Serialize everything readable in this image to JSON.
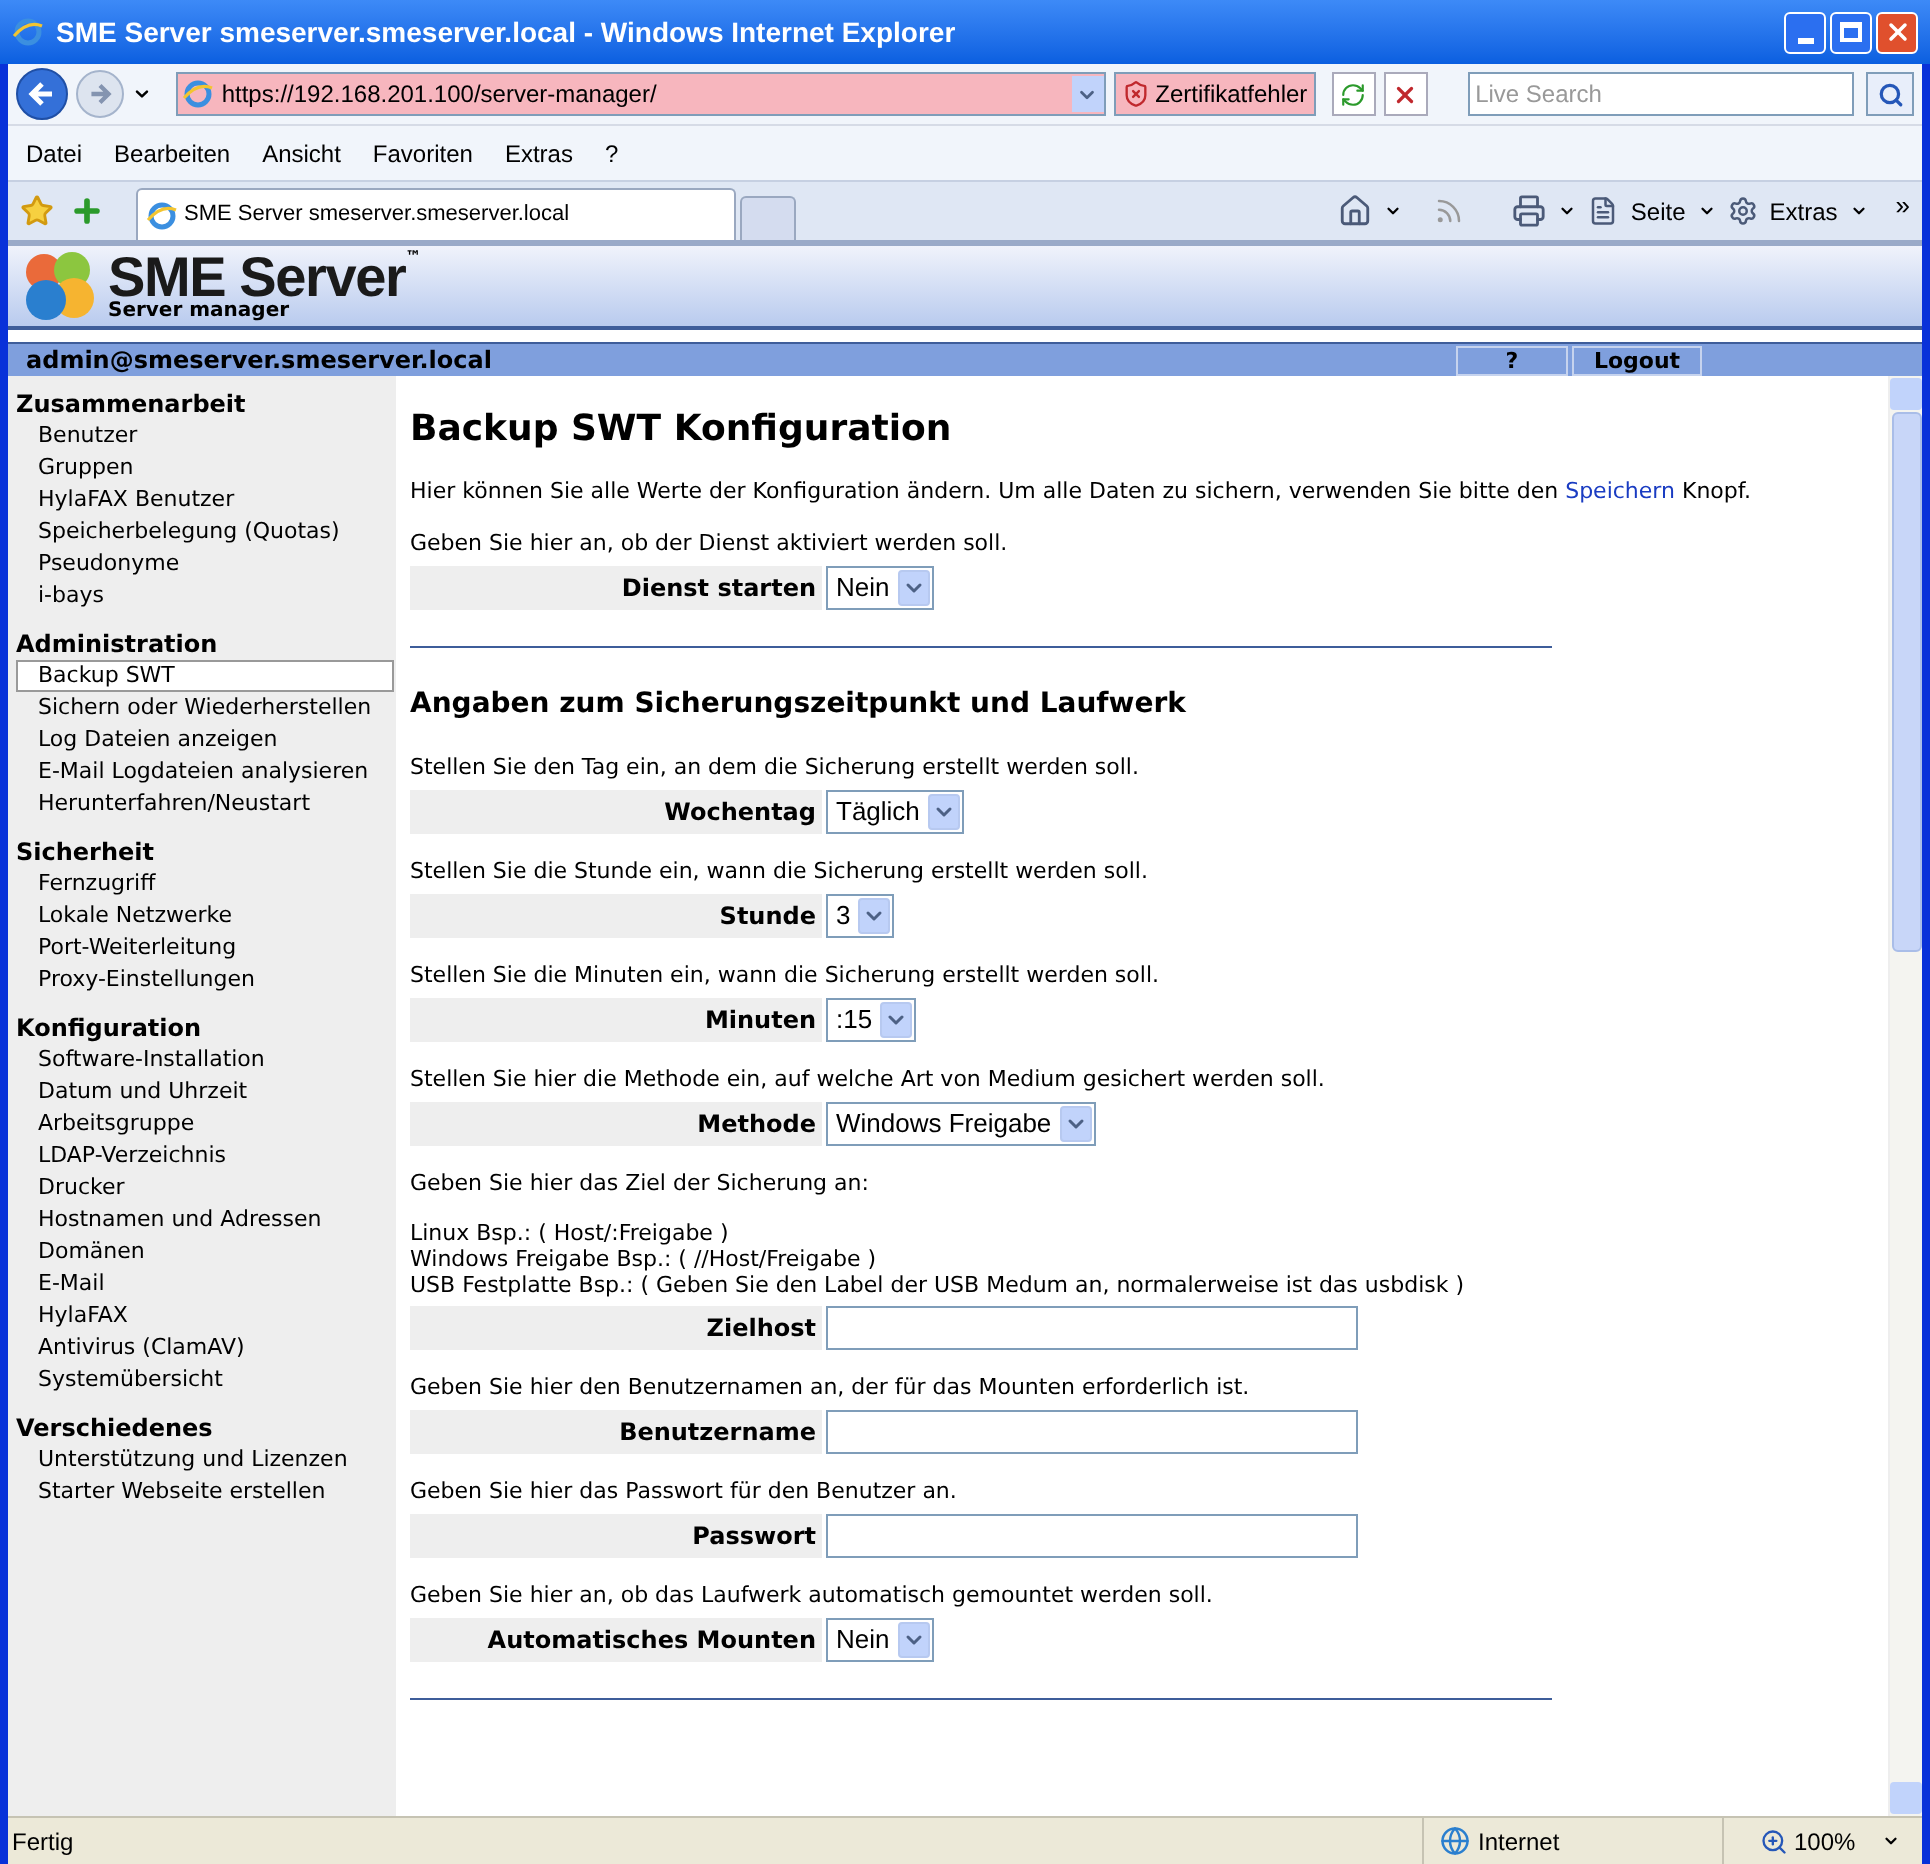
{
  "window": {
    "title": "SME Server smeserver.smeserver.local - Windows Internet Explorer"
  },
  "address_bar": {
    "url": "https://192.168.201.100/server-manager/",
    "certificate_error": "Zertifikatfehler",
    "search_placeholder": "Live Search"
  },
  "menu": [
    "Datei",
    "Bearbeiten",
    "Ansicht",
    "Favoriten",
    "Extras",
    "?"
  ],
  "tabs": [
    {
      "label": "SME Server smeserver.smeserver.local",
      "selected": true
    }
  ],
  "command_bar": {
    "page": "Seite",
    "tools": "Extras",
    "more": "»"
  },
  "header": {
    "logo": "SME Server",
    "trademark": "™",
    "subtitle": "Server manager"
  },
  "user_bar": {
    "user": "admin@smeserver.smeserver.local",
    "help": "?",
    "logout": "Logout"
  },
  "sidebar": [
    {
      "title": "Zusammenarbeit",
      "items": [
        {
          "label": "Benutzer",
          "selected": false
        },
        {
          "label": "Gruppen",
          "selected": false
        },
        {
          "label": "HylaFAX Benutzer",
          "selected": false
        },
        {
          "label": "Speicherbelegung (Quotas)",
          "selected": false
        },
        {
          "label": "Pseudonyme",
          "selected": false
        },
        {
          "label": "i-bays",
          "selected": false
        }
      ]
    },
    {
      "title": "Administration",
      "items": [
        {
          "label": "Backup SWT",
          "selected": true
        },
        {
          "label": "Sichern oder Wiederherstellen",
          "selected": false
        },
        {
          "label": "Log Dateien anzeigen",
          "selected": false
        },
        {
          "label": "E-Mail Logdateien analysieren",
          "selected": false
        },
        {
          "label": "Herunterfahren/Neustart",
          "selected": false
        }
      ]
    },
    {
      "title": "Sicherheit",
      "items": [
        {
          "label": "Fernzugriff",
          "selected": false
        },
        {
          "label": "Lokale Netzwerke",
          "selected": false
        },
        {
          "label": "Port-Weiterleitung",
          "selected": false
        },
        {
          "label": "Proxy-Einstellungen",
          "selected": false
        }
      ]
    },
    {
      "title": "Konfiguration",
      "items": [
        {
          "label": "Software-Installation",
          "selected": false
        },
        {
          "label": "Datum und Uhrzeit",
          "selected": false
        },
        {
          "label": "Arbeitsgruppe",
          "selected": false
        },
        {
          "label": "LDAP-Verzeichnis",
          "selected": false
        },
        {
          "label": "Drucker",
          "selected": false
        },
        {
          "label": "Hostnamen und Adressen",
          "selected": false
        },
        {
          "label": "Domänen",
          "selected": false
        },
        {
          "label": "E-Mail",
          "selected": false
        },
        {
          "label": "HylaFAX",
          "selected": false
        },
        {
          "label": "Antivirus (ClamAV)",
          "selected": false
        },
        {
          "label": "Systemübersicht",
          "selected": false
        }
      ]
    },
    {
      "title": "Verschiedenes",
      "items": [
        {
          "label": "Unterstützung und Lizenzen",
          "selected": false
        },
        {
          "label": "Starter Webseite erstellen",
          "selected": false
        }
      ]
    }
  ],
  "content": {
    "title": "Backup SWT Konfiguration",
    "intro": {
      "before": "Hier können Sie alle Werte der Konfiguration ändern. Um alle Daten zu sichern, verwenden Sie bitte den",
      "link": "Speichern",
      "after": "Knopf."
    },
    "blocks": [
      {
        "kind": "text",
        "text": "Geben Sie hier an, ob der Dienst aktiviert werden soll."
      },
      {
        "kind": "select",
        "label": "Dienst starten",
        "value": "Nein"
      },
      {
        "kind": "rule"
      },
      {
        "kind": "heading",
        "text": "Angaben zum Sicherungszeitpunkt und Laufwerk"
      },
      {
        "kind": "text",
        "text": "Stellen Sie den Tag ein, an dem die Sicherung erstellt werden soll."
      },
      {
        "kind": "select",
        "label": "Wochentag",
        "value": "Täglich"
      },
      {
        "kind": "text",
        "text": "Stellen Sie die Stunde ein, wann die Sicherung erstellt werden soll."
      },
      {
        "kind": "select",
        "label": "Stunde",
        "value": "3"
      },
      {
        "kind": "text",
        "text": "Stellen Sie die Minuten ein, wann die Sicherung erstellt werden soll."
      },
      {
        "kind": "select",
        "label": "Minuten",
        "value": ":15"
      },
      {
        "kind": "text",
        "text": "Stellen Sie hier die Methode ein, auf welche Art von Medium gesichert werden soll."
      },
      {
        "kind": "select",
        "label": "Methode",
        "value": "Windows Freigabe"
      },
      {
        "kind": "text",
        "text": "Geben Sie hier das Ziel der Sicherung an:"
      },
      {
        "kind": "lines",
        "lines": [
          "Linux Bsp.: ( Host/:Freigabe )",
          "Windows Freigabe Bsp.: ( //Host/Freigabe )",
          "USB Festplatte Bsp.: ( Geben Sie den Label der USB Medum an, normalerweise ist das usbdisk )"
        ]
      },
      {
        "kind": "input",
        "label": "Zielhost"
      },
      {
        "kind": "text",
        "text": "Geben Sie hier den Benutzernamen an, der für das Mounten erforderlich ist."
      },
      {
        "kind": "input",
        "label": "Benutzername"
      },
      {
        "kind": "text",
        "text": "Geben Sie hier das Passwort für den Benutzer an."
      },
      {
        "kind": "input",
        "label": "Passwort"
      },
      {
        "kind": "text",
        "text": "Geben Sie hier an, ob das Laufwerk automatisch gemountet werden soll."
      },
      {
        "kind": "select",
        "label": "Automatisches Mounten",
        "value": "Nein"
      },
      {
        "kind": "rule"
      }
    ]
  },
  "status_bar": {
    "status": "Fertig",
    "zone": "Internet",
    "zoom": "100%"
  }
}
